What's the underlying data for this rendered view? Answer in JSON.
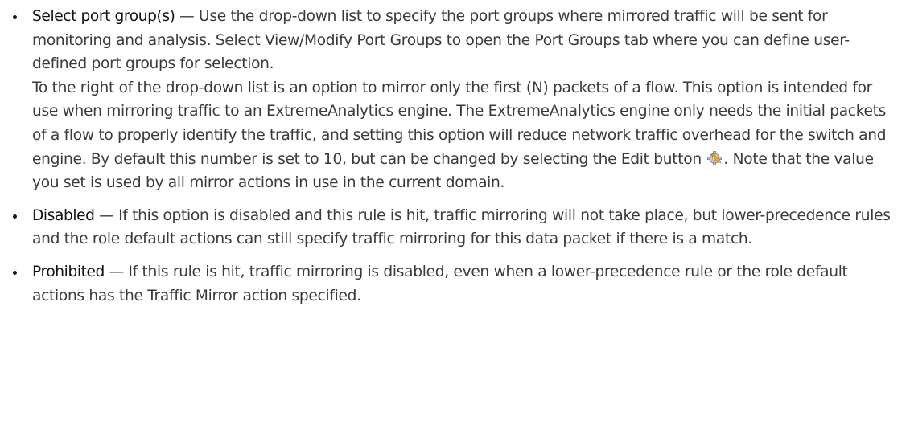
{
  "items": [
    {
      "term": "Select port group(s)",
      "text": " — Use the drop-down list to specify the port groups where mirrored traffic will be sent for monitoring and analysis. Select View/Modify Port Groups to open the Port Groups tab where you can define user-defined port groups for selection.",
      "para2_before": "To the right of the drop-down list is an option to mirror only the first (N) packets of a flow. This option is intended for use when mirroring traffic to an ExtremeAnalytics engine. The ExtremeAnalytics engine only needs the initial packets of a flow to properly identify the traffic, and setting this option will reduce network traffic overhead for the switch and engine. By default this number is set to 10, but can be changed by selecting the Edit button ",
      "para2_after": ". Note that the value you set is used by all mirror actions in use in the current domain.",
      "icon": "edit-gear-pencil-icon"
    },
    {
      "term": "Disabled",
      "text": " — If this option is disabled and this rule is hit, traffic mirroring will not take place, but lower-precedence rules and the role default actions can still specify traffic mirroring for this data packet if there is a match."
    },
    {
      "term": "Prohibited",
      "text": " — If this rule is hit, traffic mirroring is disabled, even when a lower-precedence rule or the role default actions has the Traffic Mirror action specified."
    }
  ]
}
